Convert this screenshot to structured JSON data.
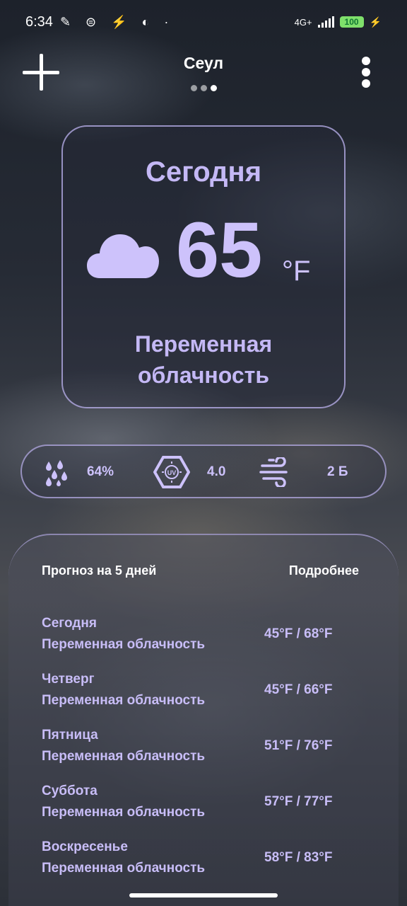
{
  "status": {
    "time": "6:34",
    "network": "4G+",
    "battery": "100"
  },
  "header": {
    "city": "Сеул",
    "add_icon": "plus-icon",
    "menu_icon": "more-vertical-icon"
  },
  "today": {
    "title": "Сегодня",
    "icon": "cloud-icon",
    "temperature": "65",
    "unit": "°F",
    "description": "Переменная облачность"
  },
  "stats": {
    "humidity": {
      "icon": "humidity-icon",
      "value": "64%"
    },
    "uv": {
      "icon": "uv-icon",
      "value": "4.0"
    },
    "wind": {
      "icon": "wind-icon",
      "value": "2 Б"
    }
  },
  "forecast": {
    "title": "Прогноз на 5 дней",
    "more_label": "Подробнее",
    "days": [
      {
        "day": "Сегодня",
        "condition": "Переменная облачность",
        "temps": "45°F / 68°F"
      },
      {
        "day": "Четверг",
        "condition": "Переменная облачность",
        "temps": "45°F / 66°F"
      },
      {
        "day": "Пятница",
        "condition": "Переменная облачность",
        "temps": "51°F / 76°F"
      },
      {
        "day": "Суббота",
        "condition": "Переменная облачность",
        "temps": "57°F / 77°F"
      },
      {
        "day": "Воскресенье",
        "condition": "Переменная облачность",
        "temps": "58°F / 83°F"
      }
    ]
  },
  "colors": {
    "accent": "#c4b8f5",
    "card_border": "#beb4f0"
  }
}
